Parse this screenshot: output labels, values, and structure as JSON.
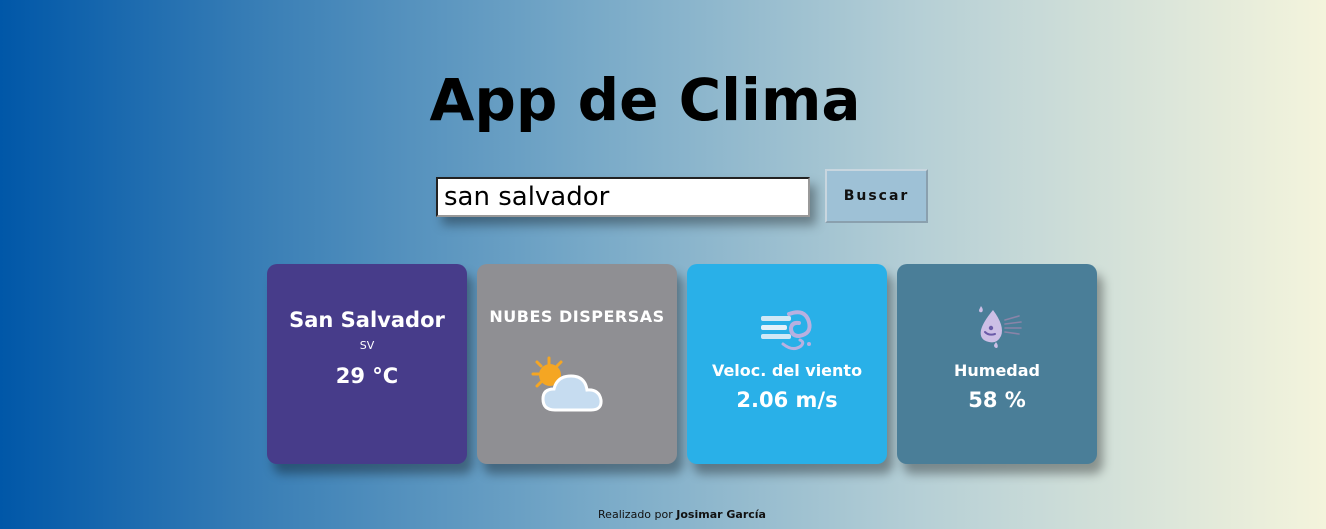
{
  "app": {
    "title": "App de Clima"
  },
  "search": {
    "value": "san salvador",
    "button_label": "Buscar"
  },
  "cards": {
    "city": {
      "name": "San Salvador",
      "country": "SV",
      "temperature": "29 °C"
    },
    "description": {
      "text": "NUBES DISPERSAS",
      "icon": "partly-cloudy-icon"
    },
    "wind": {
      "label": "Veloc. del viento",
      "value": "2.06 m/s",
      "icon": "wind-icon"
    },
    "humidity": {
      "label": "Humedad",
      "value": "58 %",
      "icon": "humidity-icon"
    }
  },
  "footer": {
    "prefix": "Realizado por",
    "author": "Josimar García"
  },
  "colors": {
    "city_card": "#473c8a",
    "description_card": "#8f8f93",
    "wind_card": "#29b0e8",
    "humidity_card": "#4a7e98"
  }
}
